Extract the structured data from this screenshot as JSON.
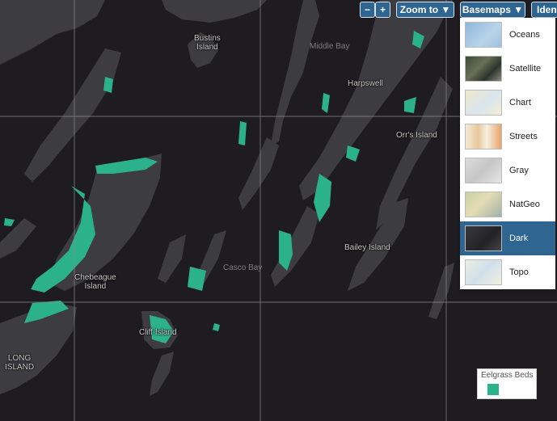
{
  "colors": {
    "water": "#1e1c20",
    "land": "#3d3c40",
    "eelgrass": "#2cb18d",
    "grid": "#8a8a8a",
    "button": "#2e6591"
  },
  "toolbar": {
    "zoom_out": "−",
    "zoom_in": "+",
    "zoom_to": "Zoom to ▼",
    "basemaps": "Basemaps ▼",
    "identify": "Iden"
  },
  "basemaps": {
    "items": [
      {
        "label": "Oceans"
      },
      {
        "label": "Satellite"
      },
      {
        "label": "Chart"
      },
      {
        "label": "Streets"
      },
      {
        "label": "Gray"
      },
      {
        "label": "NatGeo"
      },
      {
        "label": "Dark"
      },
      {
        "label": "Topo"
      }
    ],
    "selected": "Dark"
  },
  "places": {
    "bustins": "Bustins\nIsland",
    "middle_bay": "Middle Bay",
    "harpswell": "Harpswell",
    "orrs": "Orr's Island",
    "bailey": "Bailey Island",
    "casco_bay": "Casco Bay",
    "chebeague": "Chebeague\nIsland",
    "cliff": "Cliff Island",
    "long_island": "LONG\nISLAND"
  },
  "legend": {
    "title": "Eelgrass Beds"
  }
}
